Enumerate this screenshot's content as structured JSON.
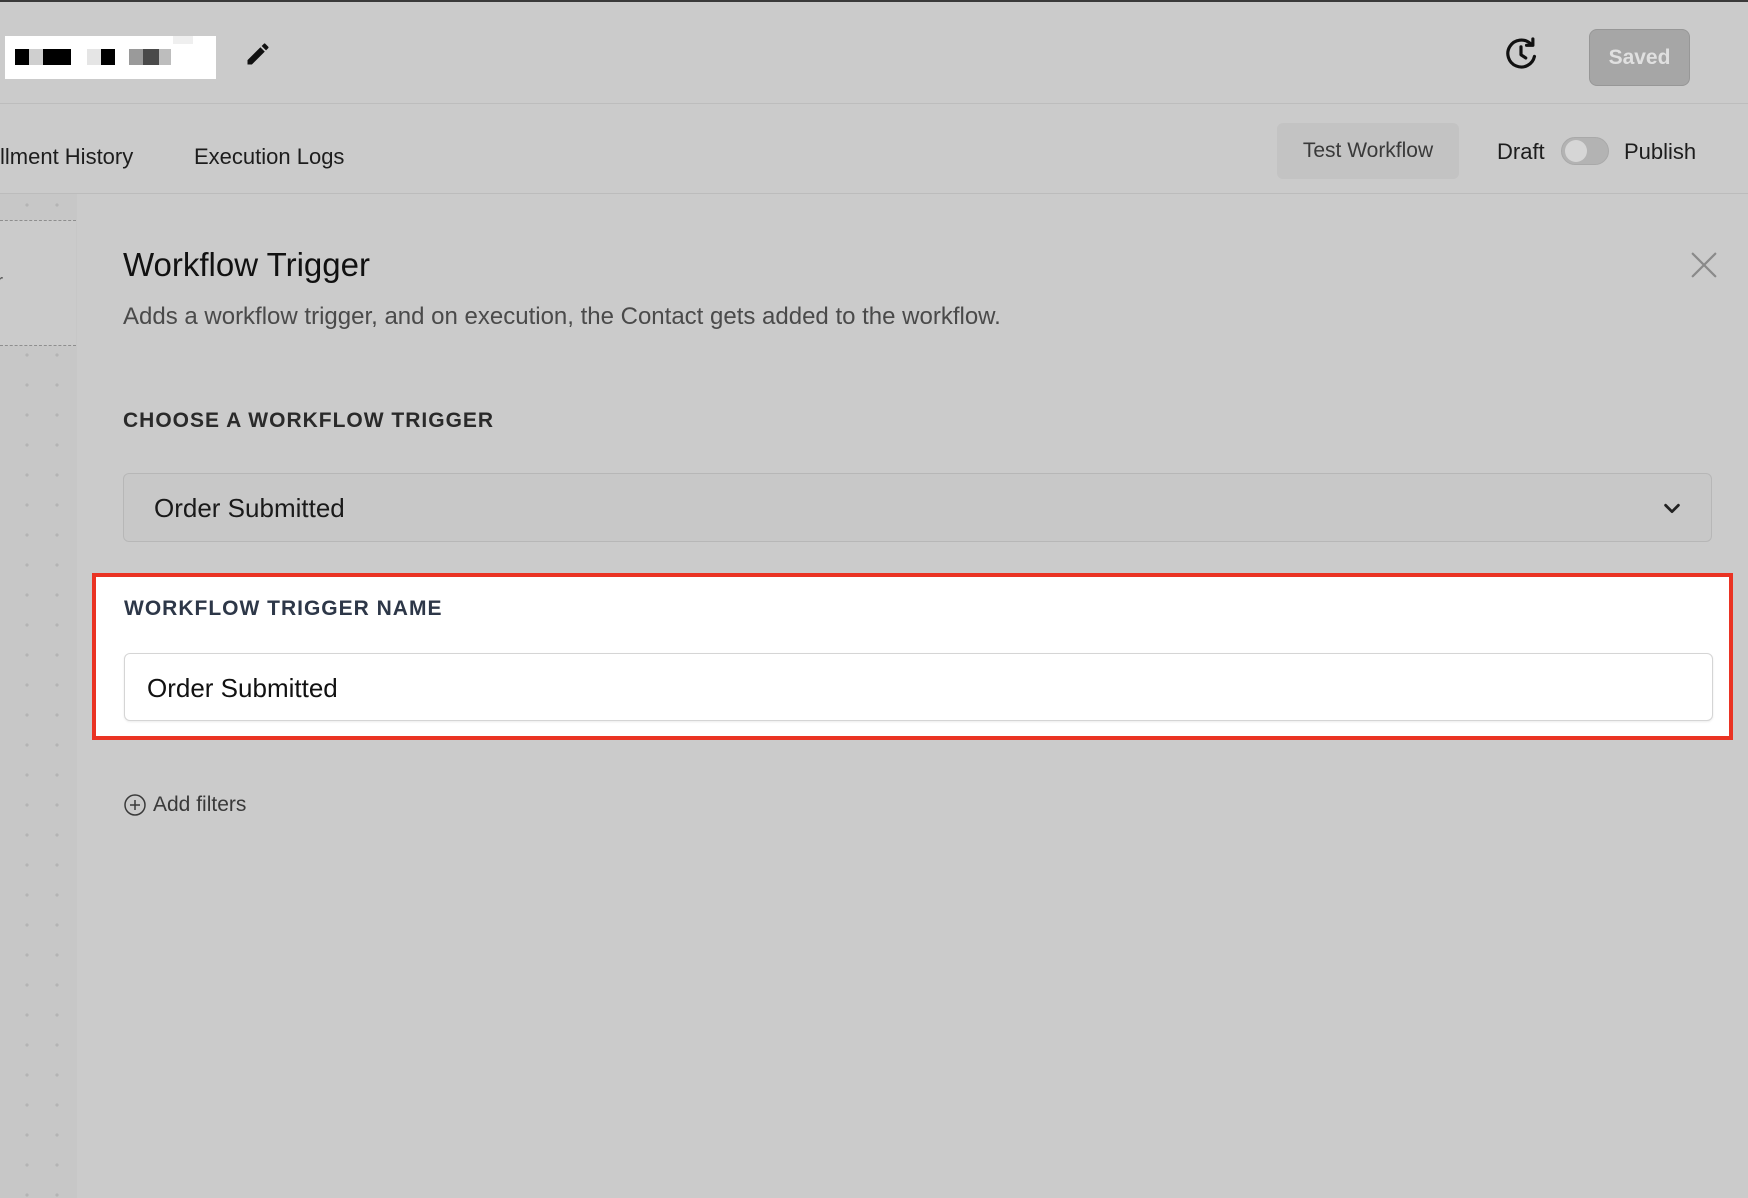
{
  "header": {
    "workflow_name_redacted": true,
    "saved_label": "Saved"
  },
  "tabs": [
    {
      "label": "llment History"
    },
    {
      "label": "Execution Logs"
    }
  ],
  "actions": {
    "test_workflow_label": "Test Workflow",
    "draft_label": "Draft",
    "publish_label": "Publish",
    "publish_toggle_on": false
  },
  "canvas": {
    "node_text": "r"
  },
  "panel": {
    "title": "Workflow Trigger",
    "description": "Adds a workflow trigger, and on execution, the Contact gets added to the workflow.",
    "choose_trigger_label": "CHOOSE A WORKFLOW TRIGGER",
    "selected_trigger": "Order Submitted",
    "trigger_name_label": "WORKFLOW TRIGGER NAME",
    "trigger_name_value": "Order Submitted",
    "add_filters_label": "Add filters"
  },
  "colors": {
    "highlight": "#ea3323",
    "background": "#cbcbcb"
  },
  "icons": [
    "pencil-icon",
    "history-icon",
    "close-icon",
    "chevron-down-icon",
    "plus-circle-icon"
  ]
}
